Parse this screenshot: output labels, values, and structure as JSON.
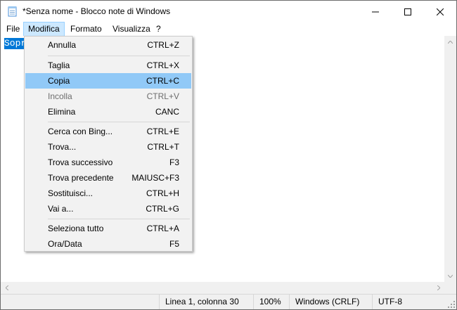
{
  "window": {
    "title": "*Senza nome - Blocco note di Windows"
  },
  "menubar": {
    "items": [
      {
        "label": "File"
      },
      {
        "label": "Modifica"
      },
      {
        "label": "Formato"
      },
      {
        "label": "Visualizza"
      },
      {
        "label": "?"
      }
    ]
  },
  "editor": {
    "selected_text": "Sopr"
  },
  "edit_menu": {
    "items": [
      {
        "label": "Annulla",
        "shortcut": "CTRL+Z"
      },
      {
        "label": "Taglia",
        "shortcut": "CTRL+X"
      },
      {
        "label": "Copia",
        "shortcut": "CTRL+C"
      },
      {
        "label": "Incolla",
        "shortcut": "CTRL+V"
      },
      {
        "label": "Elimina",
        "shortcut": "CANC"
      },
      {
        "label": "Cerca con Bing...",
        "shortcut": "CTRL+E"
      },
      {
        "label": "Trova...",
        "shortcut": "CTRL+T"
      },
      {
        "label": "Trova successivo",
        "shortcut": "F3"
      },
      {
        "label": "Trova precedente",
        "shortcut": "MAIUSC+F3"
      },
      {
        "label": "Sostituisci...",
        "shortcut": "CTRL+H"
      },
      {
        "label": "Vai a...",
        "shortcut": "CTRL+G"
      },
      {
        "label": "Seleziona tutto",
        "shortcut": "CTRL+A"
      },
      {
        "label": "Ora/Data",
        "shortcut": "F5"
      }
    ]
  },
  "statusbar": {
    "position": "Linea 1, colonna 30",
    "zoom": "100%",
    "line_ending": "Windows (CRLF)",
    "encoding": "UTF-8"
  },
  "colors": {
    "highlight": "#91c9f7",
    "selection": "#0078d7",
    "menu_active": "#cce8ff"
  }
}
